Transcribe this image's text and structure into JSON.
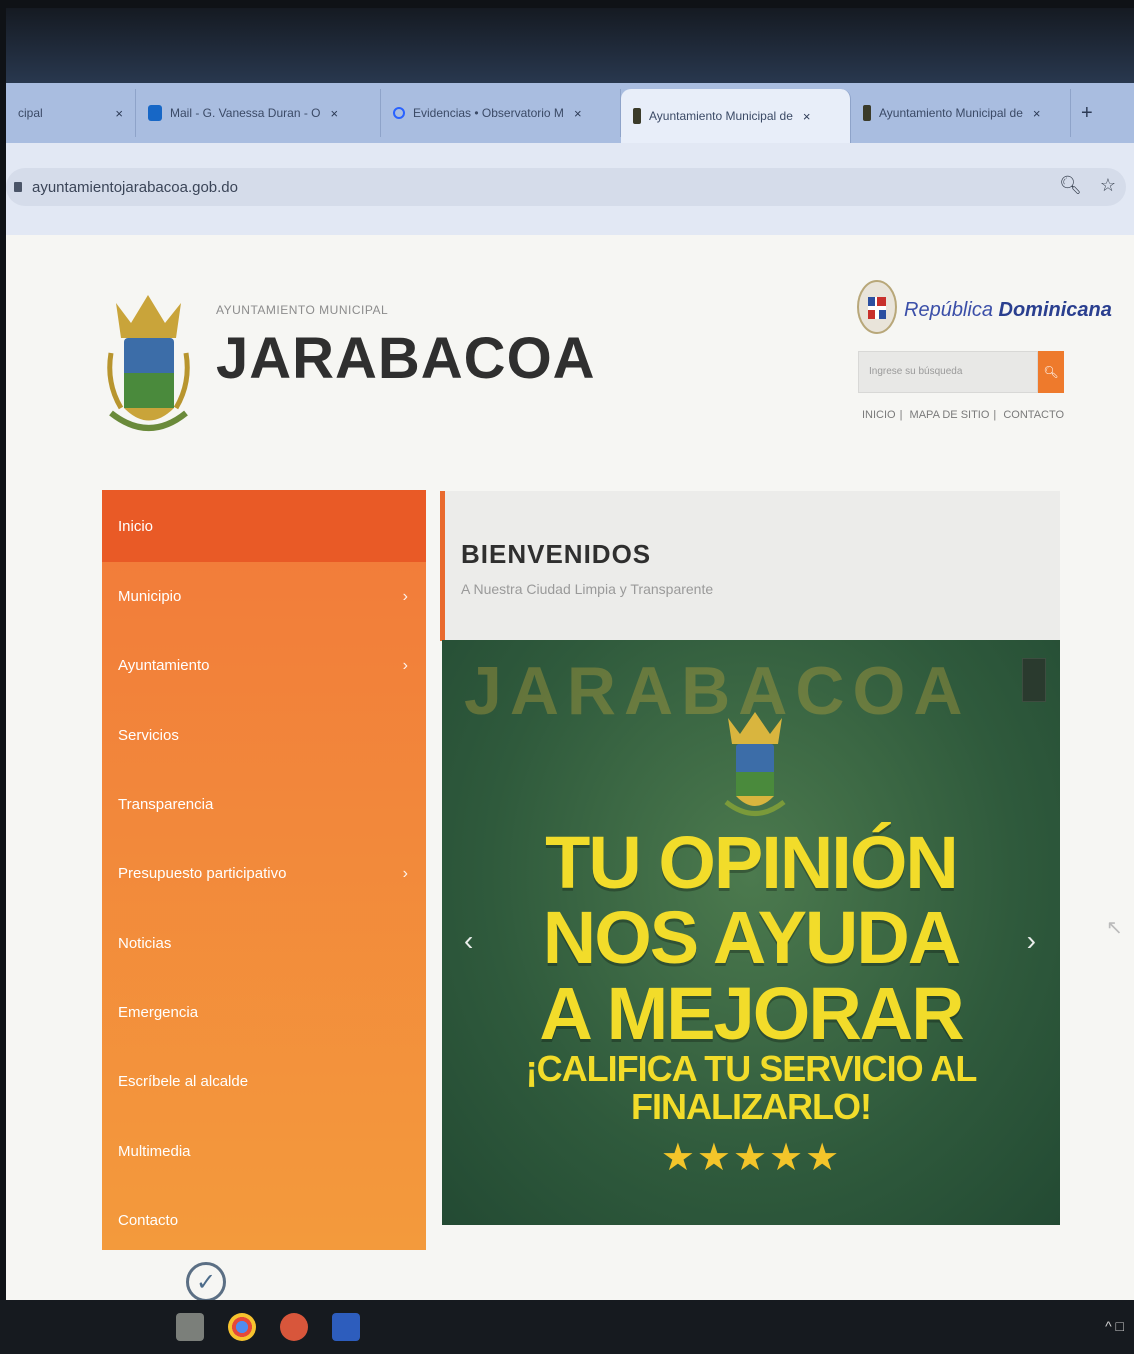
{
  "browser": {
    "tabs": [
      {
        "label": "cipal",
        "icon": "page-icon"
      },
      {
        "label": "Mail - G. Vanessa Duran - O",
        "icon": "outlook-icon"
      },
      {
        "label": "Evidencias • Observatorio M",
        "icon": "search-icon"
      },
      {
        "label": "Ayuntamiento Municipal de",
        "icon": "crest-icon",
        "active": true
      },
      {
        "label": "Ayuntamiento Municipal de",
        "icon": "crest-icon"
      }
    ],
    "close_glyph": "×",
    "new_tab_glyph": "+",
    "url": "ayuntamientojarabacoa.gob.do"
  },
  "site": {
    "logo_subtitle": "AYUNTAMIENTO MUNICIPAL",
    "logo_title": "JARABACOA",
    "rd_label_a": "República",
    "rd_label_b": "Dominicana",
    "search_placeholder": "Ingrese su búsqueda",
    "top_links": [
      "INICIO",
      "MAPA DE SITIO",
      "CONTACTO"
    ],
    "menu": [
      {
        "label": "Inicio",
        "active": true,
        "submenu": false
      },
      {
        "label": "Municipio",
        "submenu": true
      },
      {
        "label": "Ayuntamiento",
        "submenu": true
      },
      {
        "label": "Servicios",
        "submenu": false
      },
      {
        "label": "Transparencia",
        "submenu": false
      },
      {
        "label": "Presupuesto participativo",
        "submenu": true
      },
      {
        "label": "Noticias",
        "submenu": false
      },
      {
        "label": "Emergencia",
        "submenu": false
      },
      {
        "label": "Escríbele al alcalde",
        "submenu": false
      },
      {
        "label": "Multimedia",
        "submenu": false
      },
      {
        "label": "Contacto",
        "submenu": false
      }
    ],
    "welcome_title": "BIENVENIDOS",
    "welcome_subtitle": "A Nuestra Ciudad Limpia y Transparente",
    "banner": {
      "watermark": "JARABACOA",
      "line1": "TU OPINIÓN",
      "line2": "NOS AYUDA",
      "line3": "A MEJORAR",
      "sub1": "¡CALIFICA TU SERVICIO AL",
      "sub2": "FINALIZARLO!",
      "stars": "★★★★★",
      "rating": 5
    }
  },
  "colors": {
    "menu_active": "#e95a26",
    "menu_bg": "#f2853a",
    "banner_text": "#f2dc2a",
    "accent": "#ee7a2c"
  }
}
